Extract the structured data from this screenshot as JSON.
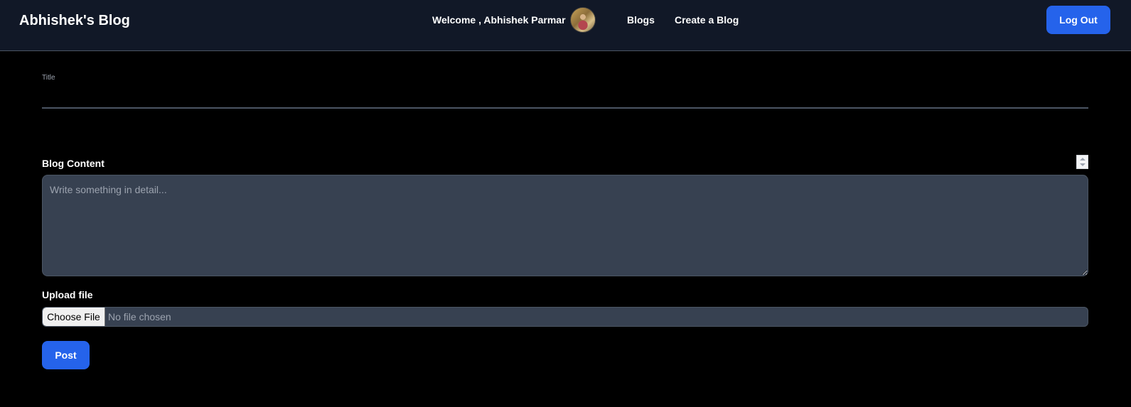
{
  "navbar": {
    "brand": "Abhishek's Blog",
    "welcome": "Welcome , Abhishek Parmar",
    "links": [
      "Blogs",
      "Create a Blog"
    ],
    "logout_label": "Log Out"
  },
  "form": {
    "title_label": "Title",
    "title_value": "",
    "content_label": "Blog Content",
    "content_placeholder": "Write something in detail...",
    "upload_label": "Upload file",
    "choose_file_label": "Choose File",
    "file_status": "No file chosen",
    "post_label": "Post"
  },
  "colors": {
    "navbar_bg": "#111827",
    "page_bg": "#000000",
    "accent": "#2563eb",
    "input_bg": "#374151"
  }
}
